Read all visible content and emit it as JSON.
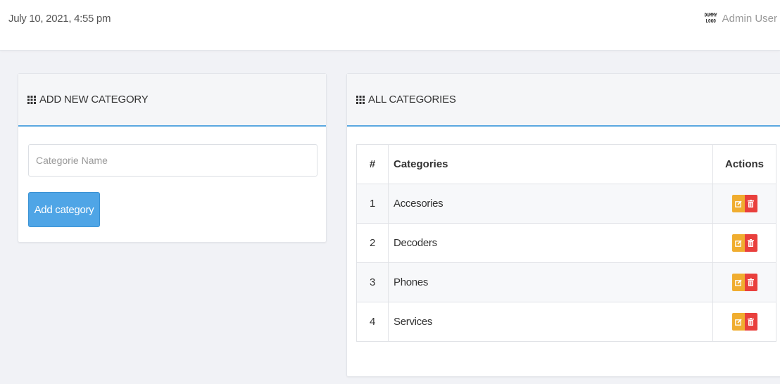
{
  "topbar": {
    "datetime": "July 10, 2021, 4:55 pm",
    "logo_line1": "DUMMY",
    "logo_line2": "LOGO",
    "user_name": "Admin User"
  },
  "add_panel": {
    "title": "ADD NEW CATEGORY",
    "input_placeholder": "Categorie Name",
    "input_value": "",
    "button_label": "Add category"
  },
  "list_panel": {
    "title": "ALL CATEGORIES",
    "columns": [
      "#",
      "Categories",
      "Actions"
    ],
    "rows": [
      {
        "num": "1",
        "name": "Accesories"
      },
      {
        "num": "2",
        "name": "Decoders"
      },
      {
        "num": "3",
        "name": "Phones"
      },
      {
        "num": "4",
        "name": "Services"
      }
    ],
    "row_actions": [
      "edit-icon",
      "trash-icon"
    ]
  },
  "colors": {
    "accent": "#4fa5e6",
    "edit": "#f0ad2f",
    "delete": "#e9403d",
    "background": "#f1f2f6"
  }
}
